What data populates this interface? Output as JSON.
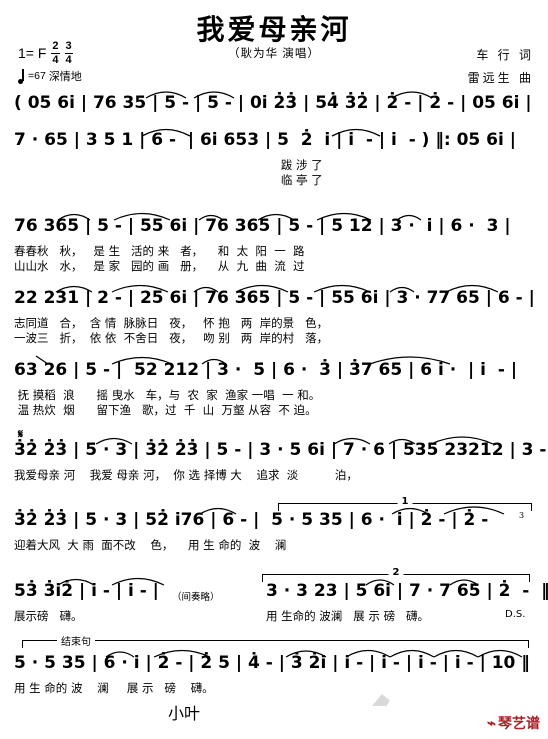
{
  "header": {
    "title": "我爱母亲河",
    "singer": "（耿为华 演唱）",
    "key_label": "1= F",
    "meter_a_num": "2",
    "meter_a_den": "4",
    "meter_b_num": "3",
    "meter_b_den": "4",
    "tempo": "=67",
    "mood": "深情地",
    "lyricist": "车 行 词",
    "composer": "雷远生 曲"
  },
  "score": {
    "line1_notes": "( 05 6i | 76 35 | 5 - | 5 - | 0i 2̇3̇ | 54̇ 3̇2̇ | 2̇ - | 2̇ - | 05 6i |",
    "line2_notes": "7 · 65 | 3 5 1 | 6 -  | 6i 653 | 5  2̇  i | i  - | i  - ) ‖: 05 6i |",
    "line2_lyric_a": "                                                                         跋 涉 了",
    "line2_lyric_b": "                                                                         临 亭 了",
    "line3_notes": "76 365 | 5 - | 55 6i | 76 365 | 5 - | 5 12 | 3 ·  i | 6 ·  3 |",
    "line3_lyric_a": "春春秋   秋，   是 生   活的 来   者，    和  太  阳  一  路",
    "line3_lyric_b": "山山水   水，   是 家   园的 画   册，    从  九  曲  流  过",
    "line4_notes": "22 231 | 2 - | 25 6i | 76 365 | 5 - | 55 6i | 3 · 77 65 | 6 - |",
    "line4_lyric_a": "志同道   合，  含 情  脉脉日   夜，   怀 抱   两  岸的景   色，",
    "line4_lyric_b": "一波三   折，  依 依  不舍日   夜，   吻 别   两  岸的村   落，",
    "line5_notes": "63 26 | 5 - |  52 212 | 3 ·  5 | 6 ·  3̇ | 3̇7 65 | 6 i ·  | i  - |",
    "line5_lyric_a": " 抚 摸稻  浪      摇 曳水   车，与  农  家  渔家 一唱  一 和。",
    "line5_lyric_b": " 温 热炊  烟      留下渔   歌，过  千  山  万壑 从容  不 迫。",
    "line6_notes": "3̇2̇ 2̇3̇ | 5 · 3 | 3̇2̇ 2̇3̇ | 5 - | 3 · 5 6i | 7 · 6 | 535 23212 | 3 - |",
    "line6_lyric": "我爱母亲 河    我爱 母亲 河，  你 选 择博 大    追求  淡          泊，",
    "line7_notes": "3̇2̇ 2̇3̇ | 5 · 3 | 52̇ i76 | 6 - |  5 · 5 35 | 6 ·  i | 2̇ - | 2̇ -",
    "line7_lyric": "迎着大风  大 雨  面不改    色，    用 生 命的  波    澜",
    "line8_notes": "53̇ 3̇i2̇ | i - | i - |",
    "line8_lyric": "展示磅   礴。",
    "line8_interlude": "（间奏略）",
    "line8_notes_b": "3 · 3 23 | 5 6i | 7 · 7 65 | 2̇  -  ‖",
    "line8_lyric_b": "用 生命的 波澜   展 示 磅   礴。",
    "line8_ds": "D.S.",
    "line9_notes": "5 · 5 35 | 6 · i | 2̇ - | 2̇ 5 | 4̇ - | 3̇ 2̇i | i - | i - | i - | i - | 10 ‖",
    "line9_lyric": "用 生 命的 波    澜     展 示   磅    礴。",
    "ending_bracket_label": "结束句",
    "volta1_label": "1",
    "volta2_label": "2",
    "triplet_label": "3",
    "segno": "𝄋"
  },
  "footer": {
    "author_note": "小叶",
    "logo_text": "琴艺谱",
    "logo_color": "#a81f24"
  }
}
